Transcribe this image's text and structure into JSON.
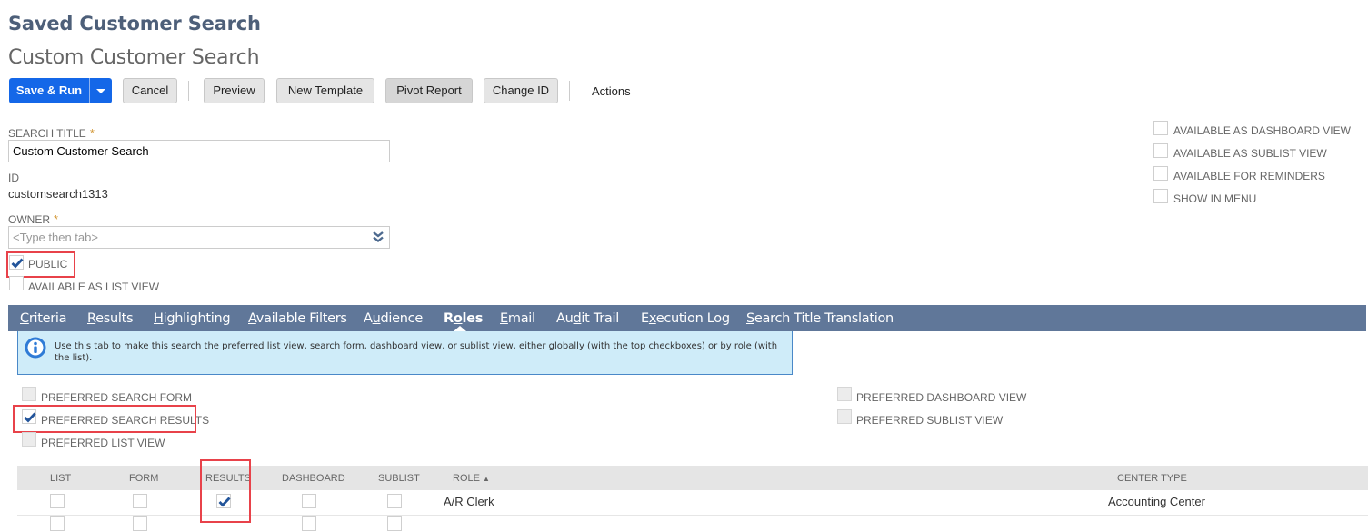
{
  "header": {
    "page_title": "Saved Customer Search",
    "record_title": "Custom Customer Search"
  },
  "toolbar": {
    "save_run_label": "Save & Run",
    "cancel_label": "Cancel",
    "preview_label": "Preview",
    "new_template_label": "New Template",
    "pivot_report_label": "Pivot Report",
    "change_id_label": "Change ID",
    "actions_label": "Actions"
  },
  "form": {
    "search_title": {
      "label": "SEARCH TITLE",
      "required_mark": "*",
      "value": "Custom Customer Search"
    },
    "id": {
      "label": "ID",
      "value": "customsearch1313"
    },
    "owner": {
      "label": "OWNER",
      "required_mark": "*",
      "value": "",
      "placeholder": "<Type then tab>"
    },
    "public": {
      "label": "PUBLIC",
      "checked": true
    },
    "available_as_list_view": {
      "label": "AVAILABLE AS LIST VIEW",
      "checked": false
    }
  },
  "right_options": [
    {
      "label": "AVAILABLE AS DASHBOARD VIEW",
      "checked": false
    },
    {
      "label": "AVAILABLE AS SUBLIST VIEW",
      "checked": false
    },
    {
      "label": "AVAILABLE FOR REMINDERS",
      "checked": false
    },
    {
      "label": "SHOW IN MENU",
      "checked": false
    }
  ],
  "tabs": [
    {
      "label": "Criteria",
      "accesskey": "C",
      "active": false
    },
    {
      "label": "Results",
      "accesskey": "R",
      "active": false
    },
    {
      "label": "Highlighting",
      "accesskey": "H",
      "active": false
    },
    {
      "label": "Available Filters",
      "accesskey": "A",
      "active": false
    },
    {
      "label": "Audience",
      "accesskey": "u",
      "active": false
    },
    {
      "label": "Roles",
      "accesskey": "o",
      "active": true
    },
    {
      "label": "Email",
      "accesskey": "E",
      "active": false
    },
    {
      "label": "Audit Trail",
      "accesskey": "d",
      "active": false
    },
    {
      "label": "Execution Log",
      "accesskey": "x",
      "active": false
    },
    {
      "label": "Search Title Translation",
      "accesskey": "S",
      "active": false
    }
  ],
  "info": {
    "icon": "info-icon",
    "text": "Use this tab to make this search the preferred list view, search form, dashboard view, or sublist view, either globally (with the top checkboxes) or by role (with the list)."
  },
  "preferred": {
    "search_form": {
      "label": "PREFERRED SEARCH FORM",
      "checked": false
    },
    "search_results": {
      "label": "PREFERRED SEARCH RESULTS",
      "checked": true
    },
    "list_view": {
      "label": "PREFERRED LIST VIEW",
      "checked": false
    },
    "dashboard_view": {
      "label": "PREFERRED DASHBOARD VIEW",
      "checked": false
    },
    "sublist_view": {
      "label": "PREFERRED SUBLIST VIEW",
      "checked": false
    }
  },
  "roles_table": {
    "columns": [
      "LIST",
      "FORM",
      "RESULTS",
      "DASHBOARD",
      "SUBLIST",
      "ROLE",
      "CENTER TYPE"
    ],
    "sort_indicator": "▲",
    "rows": [
      {
        "list": false,
        "form": false,
        "results": true,
        "dashboard": false,
        "sublist": false,
        "role": "A/R Clerk",
        "center_type": "Accounting Center"
      }
    ]
  }
}
